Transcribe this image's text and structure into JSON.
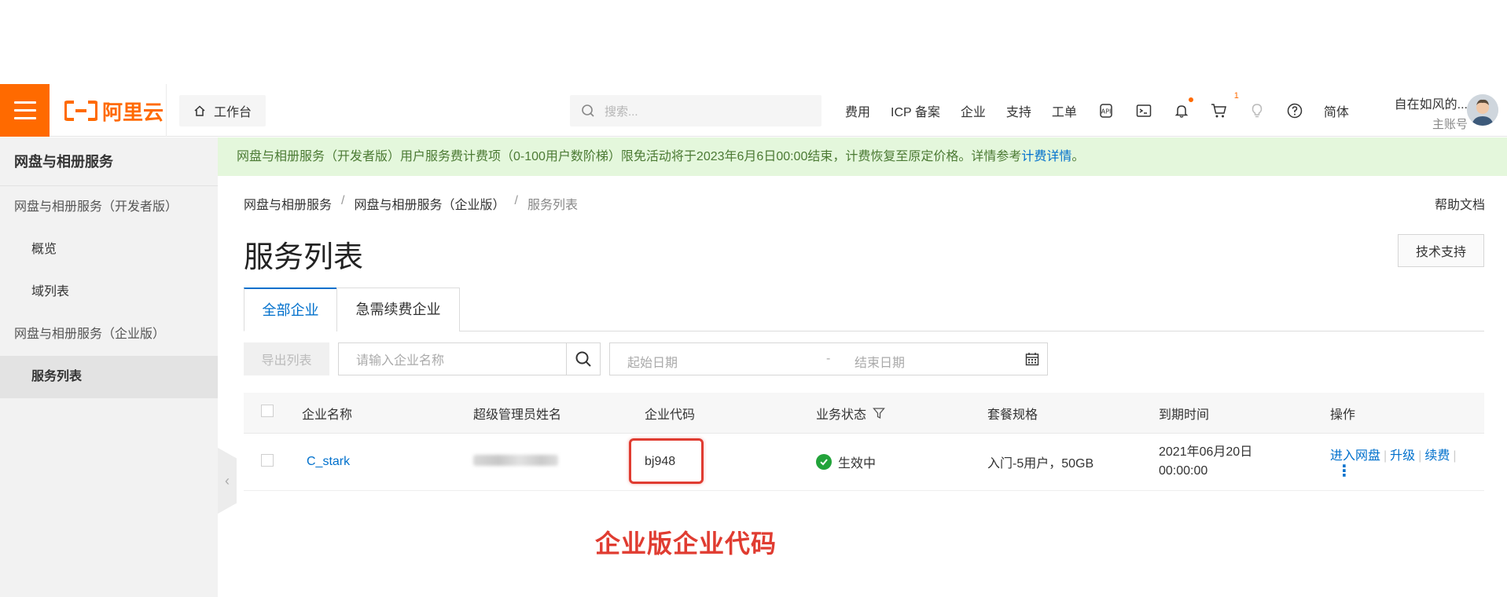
{
  "topbar": {
    "brand": "阿里云",
    "workbench_label": "工作台",
    "search_placeholder": "搜索...",
    "nav": [
      "费用",
      "ICP 备案",
      "企业",
      "支持",
      "工单"
    ],
    "cart_count": "1",
    "lang": "简体",
    "account_name": "自在如风的...",
    "account_type": "主账号"
  },
  "sidebar": {
    "title": "网盘与相册服务",
    "group_dev": "网盘与相册服务（开发者版）",
    "item_overview": "概览",
    "item_domains": "域列表",
    "group_ent": "网盘与相册服务（企业版）",
    "item_services": "服务列表"
  },
  "notice": {
    "text": "网盘与相册服务（开发者版）用户服务费计费项（0-100用户数阶梯）限免活动将于2023年6月6日00:00结束，计费恢复至原定价格。详情参考",
    "link": "计费详情",
    "end": "。"
  },
  "breadcrumb": {
    "b1": "网盘与相册服务",
    "b2": "网盘与相册服务（企业版）",
    "b3": "服务列表",
    "sep": "/"
  },
  "help_doc": "帮助文档",
  "page_title": "服务列表",
  "tech_support": "技术支持",
  "tabs": {
    "all": "全部企业",
    "renew": "急需续费企业"
  },
  "toolbar": {
    "export": "导出列表",
    "name_placeholder": "请输入企业名称",
    "start_date": "起始日期",
    "dash": "-",
    "end_date": "结束日期"
  },
  "table": {
    "headers": {
      "name": "企业名称",
      "admin": "超级管理员姓名",
      "code": "企业代码",
      "status": "业务状态",
      "plan": "套餐规格",
      "expire": "到期时间",
      "ops": "操作"
    },
    "rows": [
      {
        "name": "C_stark",
        "code": "bj948",
        "status": "生效中",
        "plan": "入门-5用户，50GB",
        "expire_date": "2021年06月20日",
        "expire_time": "00:00:00",
        "op_enter": "进入网盘",
        "op_upgrade": "升级",
        "op_renew": "续费"
      }
    ]
  },
  "annotation": "企业版企业代码",
  "colors": {
    "brand_orange": "#ff6a00",
    "link_blue": "#0070cc",
    "annotation_red": "#e03c31",
    "notice_bg": "#e4f7dc"
  }
}
